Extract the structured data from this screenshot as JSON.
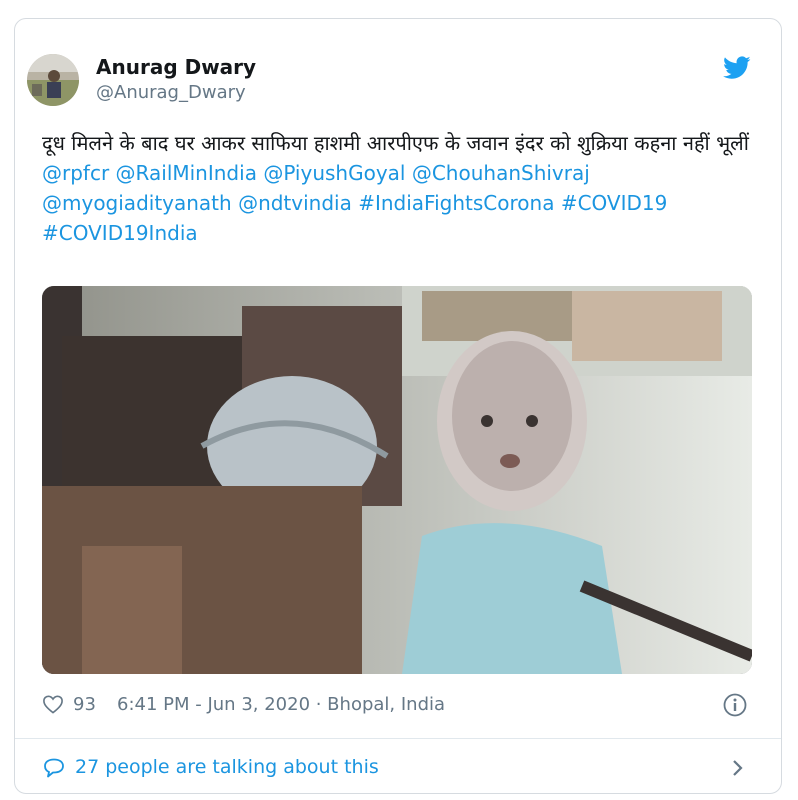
{
  "author": {
    "name": "Anurag Dwary",
    "handle": "@Anurag_Dwary"
  },
  "tweet": {
    "text": "दूध मिलने के बाद घर आकर साफिया हाशमी आरपीएफ के जवान इंदर को शुक्रिया कहना नहीं भूलीं",
    "mentions": [
      "@rpfcr",
      "@RailMinIndia",
      "@PiyushGoyal",
      "@ChouhanShivraj",
      "@myogiadityanath",
      "@ndtvindia"
    ],
    "hashtags": [
      "#IndiaFightsCorona",
      "#COVID19",
      "#COVID19India"
    ]
  },
  "meta": {
    "likes": "93",
    "timestamp": "6:41 PM - Jun 3, 2020 · Bhopal, India"
  },
  "conversation": {
    "text": "27 people are talking about this"
  },
  "icons": {
    "brand": "twitter-bird-icon",
    "like": "heart-icon",
    "info": "info-icon",
    "reply": "speech-bubble-icon",
    "chevron": "chevron-right-icon"
  },
  "colors": {
    "link": "#1b95e0",
    "secondary": "#657786",
    "border": "#d6dbe0"
  }
}
